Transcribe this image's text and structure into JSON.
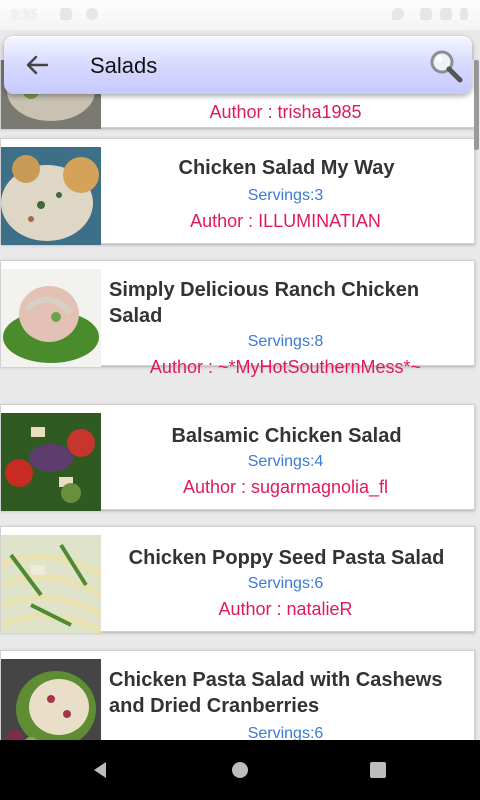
{
  "status_bar": {
    "time": "3:35"
  },
  "app_bar": {
    "title": "Salads",
    "back_icon": "arrow-left-icon",
    "search_icon": "magnifier-icon"
  },
  "recipes": [
    {
      "name": "",
      "servings": "",
      "author": "Author : trisha1985"
    },
    {
      "name": "Chicken Salad My Way",
      "servings": "Servings:3",
      "author": "Author : ILLUMINATIAN"
    },
    {
      "name": "Simply Delicious Ranch Chicken Salad",
      "servings": "Servings:8",
      "author": "Author : ~*MyHotSouthernMess*~"
    },
    {
      "name": "Balsamic Chicken Salad",
      "servings": "Servings:4",
      "author": "Author : sugarmagnolia_fl"
    },
    {
      "name": "Chicken Poppy Seed Pasta Salad",
      "servings": "Servings:6",
      "author": "Author : natalieR"
    },
    {
      "name": "Chicken Pasta Salad with Cashews and Dried Cranberries",
      "servings": "Servings:6",
      "author": ""
    }
  ],
  "colors": {
    "servings": "#3a7bd5",
    "author": "#e0195f",
    "title_text": "#333333"
  },
  "nav_bar": {
    "back": "triangle-back-icon",
    "home": "circle-home-icon",
    "recents": "square-recents-icon"
  }
}
